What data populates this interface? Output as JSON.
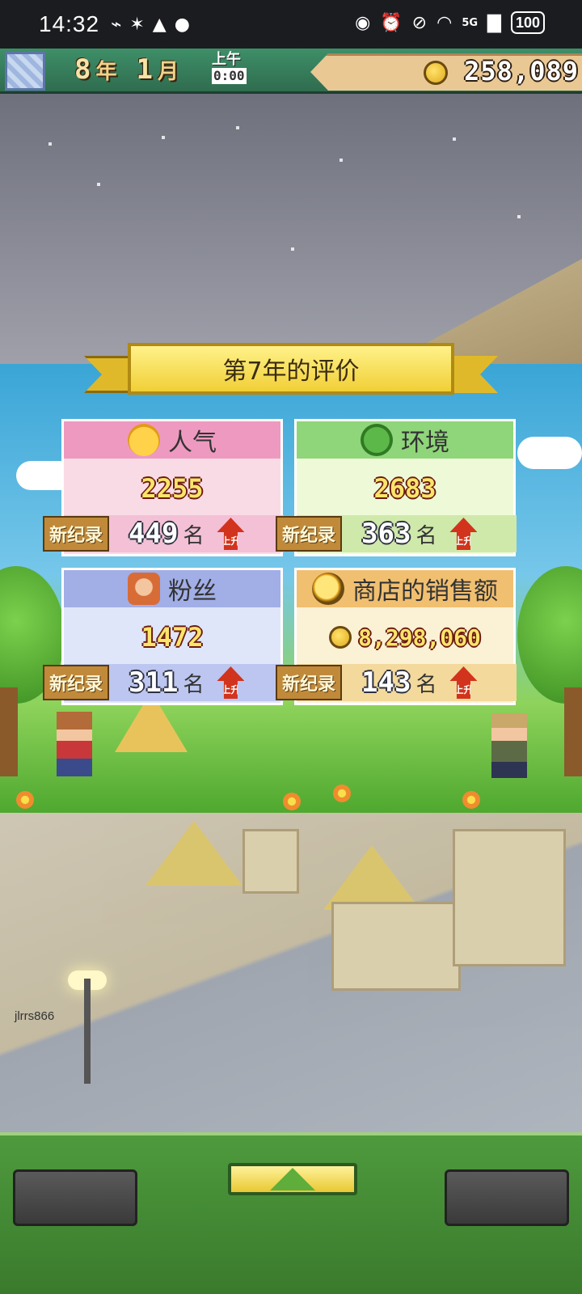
{
  "status_bar": {
    "time": "14:32",
    "battery": "100",
    "network": "5G",
    "icons_left": [
      "link-icon",
      "bug-icon",
      "qq-icon",
      "wechat-icon"
    ],
    "icons_right": [
      "eye-icon",
      "alarm-icon",
      "mute-icon",
      "wifi-icon",
      "signal-icon"
    ]
  },
  "top_bar": {
    "year_value": "8",
    "year_unit": "年",
    "month_value": "1",
    "month_unit": "月",
    "period": "上午",
    "clock": "0:00",
    "money": "258,089"
  },
  "result": {
    "title": "第7年的评价",
    "cards": [
      {
        "label": "人气",
        "value": "2255",
        "record": "新纪录",
        "rank": "449",
        "rank_unit": "名",
        "trend": "上升",
        "icon": "smile-icon",
        "color": "#ee9ac0"
      },
      {
        "label": "环境",
        "value": "2683",
        "record": "新纪录",
        "rank": "363",
        "rank_unit": "名",
        "trend": "上升",
        "icon": "tree-icon",
        "color": "#8fd57a"
      },
      {
        "label": "粉丝",
        "value": "1472",
        "record": "新纪录",
        "rank": "311",
        "rank_unit": "名",
        "trend": "上升",
        "icon": "fan-icon",
        "color": "#a2aee6"
      },
      {
        "label": "商店的销售额",
        "value": "8,298,060",
        "record": "新纪录",
        "rank": "143",
        "rank_unit": "名",
        "trend": "上升",
        "icon": "coin-icon",
        "color": "#f1bf70"
      }
    ]
  },
  "watermark": "jlrrs866",
  "bottom_bar": {
    "left_button": "",
    "center_button": "up-arrow-icon",
    "right_button": ""
  }
}
